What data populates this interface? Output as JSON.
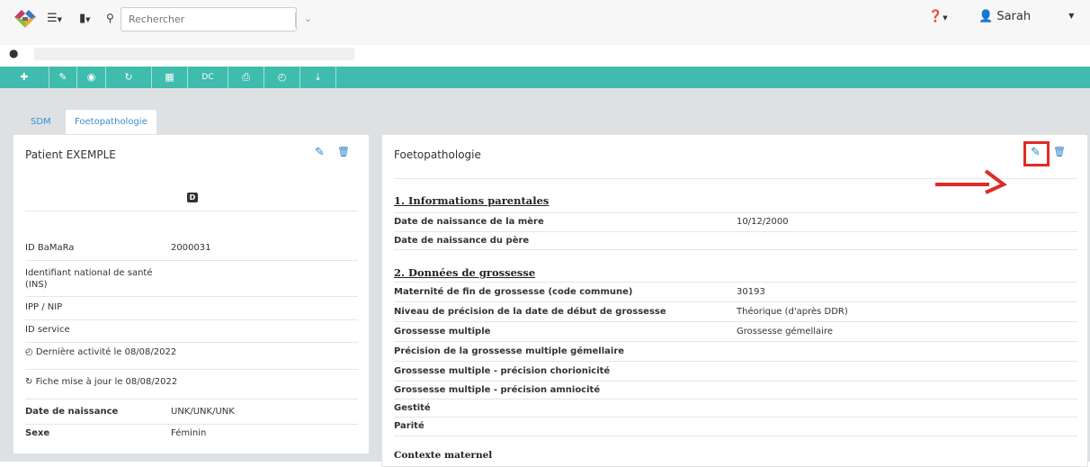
{
  "header": {
    "search": {
      "placeholder": "Rechercher"
    },
    "user": {
      "name": "Sarah"
    }
  },
  "tabs": [
    {
      "label": "SDM"
    },
    {
      "label": "Foetopathologie"
    }
  ],
  "toolbar": {
    "dc_label": "DC"
  },
  "left_panel": {
    "title": "Patient EXEMPLE",
    "badge": "D",
    "fields": [
      {
        "label": "ID BaMaRa",
        "value": "2000031"
      },
      {
        "label": "Identifiant national de santé (INS)",
        "value": ""
      },
      {
        "label": "IPP / NIP",
        "value": ""
      },
      {
        "label": "ID service",
        "value": ""
      }
    ],
    "activity": "Dernière activité le  08/08/2022",
    "updated": "Fiche mise à jour le  08/08/2022",
    "birth": {
      "label": "Date de naissance",
      "value": "UNK/UNK/UNK"
    },
    "sex": {
      "label": "Sexe",
      "value": "Féminin"
    }
  },
  "right_panel": {
    "title": "Foetopathologie",
    "sections": [
      {
        "heading": "1. Informations parentales",
        "rows": [
          {
            "label": "Date de naissance de la mère",
            "value": "10/12/2000"
          },
          {
            "label": "Date de naissance du père",
            "value": ""
          }
        ]
      },
      {
        "heading": "2. Données de grossesse",
        "rows": [
          {
            "label": "Maternité de fin de grossesse (code commune)",
            "value": "30193"
          },
          {
            "label": "Niveau de précision de la date de début de grossesse",
            "value": "Théorique (d'après DDR)"
          },
          {
            "label": "Grossesse multiple",
            "value": "Grossesse gémellaire"
          },
          {
            "label": "Précision de la grossesse multiple gémellaire",
            "value": ""
          },
          {
            "label": "Grossesse multiple - précision chorionicité",
            "value": ""
          },
          {
            "label": "Grossesse multiple - précision amniocité",
            "value": ""
          },
          {
            "label": "Gestité",
            "value": ""
          },
          {
            "label": "Parité",
            "value": ""
          }
        ]
      }
    ],
    "subheading": "Contexte maternel"
  },
  "colors": {
    "accent": "#3fbcad",
    "link": "#2f7fc7",
    "annotation": "#e02b27"
  },
  "icons": [
    "logo-icon",
    "menu-icon",
    "chart-icon",
    "search-icon",
    "map-pin-icon",
    "plus-icon",
    "pencil-icon",
    "refresh-icon",
    "calendar-icon",
    "print-icon",
    "clock-icon",
    "download-icon",
    "help-icon",
    "user-icon",
    "trash-icon",
    "red-arrow"
  ]
}
